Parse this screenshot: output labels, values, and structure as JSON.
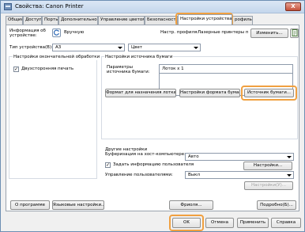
{
  "window": {
    "title": "Свойства: Canon Printer",
    "close_glyph": "X"
  },
  "tabs": [
    {
      "label": "Общие"
    },
    {
      "label": "Доступ"
    },
    {
      "label": "Порты"
    },
    {
      "label": "Дополнительно"
    },
    {
      "label": "Управление цветом"
    },
    {
      "label": "Безопасность"
    },
    {
      "label": "Настройки устройства"
    },
    {
      "label": "рофиль"
    }
  ],
  "top": {
    "info_label": "Информация об устройстве:",
    "manual_label": "Вручную",
    "profile_label": "Настр. профиля:",
    "profile_value": "Лазерные принтеры пользоват",
    "change_button": "Изменить...",
    "device_type_label": "Тип устройства(В):",
    "device_type_value": "A3",
    "color_value": "Цвет"
  },
  "finishing": {
    "title": "Настройки окончательной обработки",
    "duplex_label": "Двухсторонняя печать",
    "duplex_checked": "✓"
  },
  "paper_source": {
    "title": "Настройки источника бумаги",
    "paper_source_label": "Параметры источника бумаги:",
    "paper_source_value": "Лоток x 1",
    "tray_format_button": "Формат для назначения лотка...",
    "paper_format_button": "Настройки формата бумаги...",
    "source_button": "Источник бумаги..."
  },
  "other": {
    "title": "Другие настройки",
    "spooling_label": "Буферизация на хост-компьютере:",
    "spooling_value": "Авто",
    "set_user_label": "Задать информацию пользователя",
    "set_user_checked": "✓",
    "settings_button": "Настройки...",
    "user_mgmt_label": "Управление пользователями:",
    "user_mgmt_value": "Выкл",
    "user_settings_button": "Настройки(У)..."
  },
  "bottom": {
    "about_button": "О программе",
    "language_button": "Языковые настройки...",
    "fonts_button": "Фриоля...",
    "details_button": "Подробно(Б)..."
  },
  "footer": {
    "ok": "OK",
    "cancel": "Отмена",
    "apply": "Применить",
    "help": "Справка"
  },
  "colors": {
    "highlight": "#f0a040",
    "accent": "#3a78c8"
  }
}
